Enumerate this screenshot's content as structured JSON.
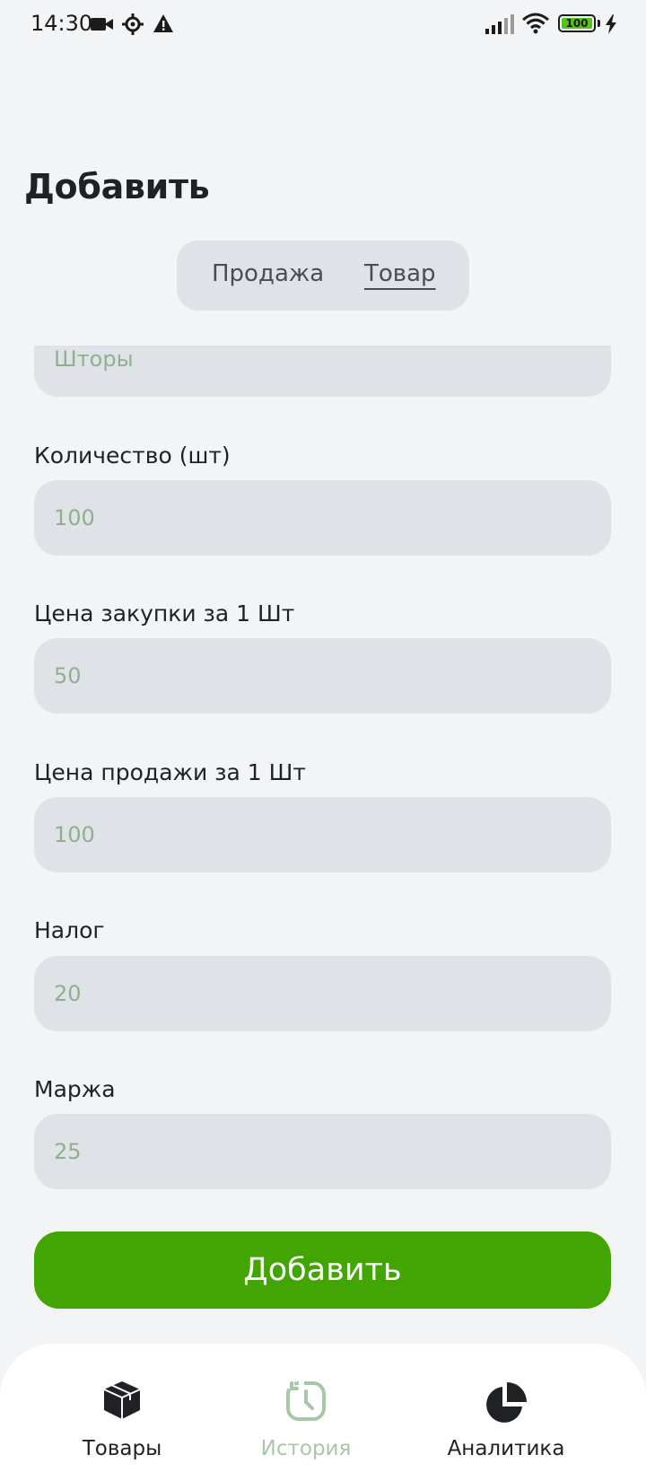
{
  "status_bar": {
    "time": "14:30",
    "battery_level": "100",
    "icons": [
      "video-camera-icon",
      "settings-gear-icon",
      "warning-icon",
      "signal-icon",
      "wifi-icon",
      "battery-icon",
      "charging-bolt-icon"
    ]
  },
  "page": {
    "title": "Добавить"
  },
  "segmented": {
    "sale": "Продажа",
    "product": "Товар",
    "selected": "product"
  },
  "form": {
    "name": {
      "value": "Шторы"
    },
    "quantity": {
      "label": "Количество (шт)",
      "value": "100"
    },
    "purchase_price": {
      "label": "Цена закупки за 1 Шт",
      "value": "50"
    },
    "sale_price": {
      "label": "Цена продажи за 1 Шт",
      "value": "100"
    },
    "tax": {
      "label": "Налог",
      "value": "20"
    },
    "margin": {
      "label": "Маржа",
      "value": "25"
    },
    "submit_label": "Добавить"
  },
  "nav": {
    "items": [
      {
        "label": "Товары",
        "icon": "box-icon",
        "state": "normal"
      },
      {
        "label": "История",
        "icon": "history-icon",
        "state": "disabled"
      },
      {
        "label": "Аналитика",
        "icon": "pie-chart-icon",
        "state": "normal"
      }
    ]
  },
  "colors": {
    "background": "#f3f4f6",
    "input_bg": "#dfe3e7",
    "input_text": "#8fb08f",
    "accent": "#43a504",
    "nav_inactive": "#a8c7a8"
  }
}
